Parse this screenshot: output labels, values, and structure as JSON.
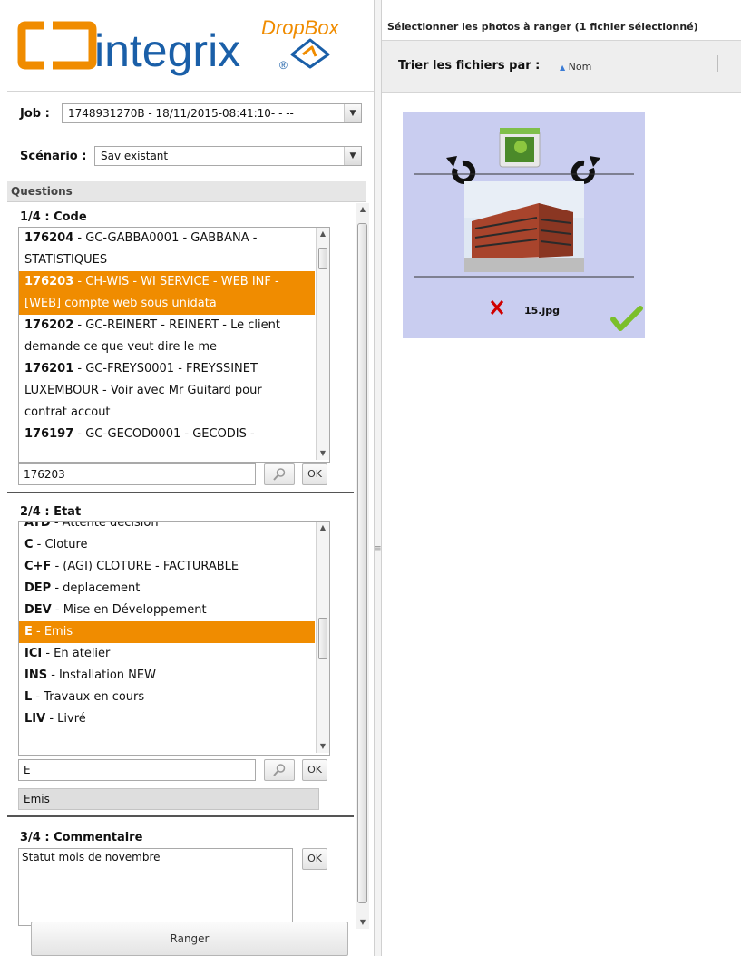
{
  "logo": {
    "brand": "integrix",
    "product": "DropBox"
  },
  "job": {
    "label": "Job :",
    "value": "1748931270B - 18/11/2015-08:41:10- - --"
  },
  "scenario": {
    "label": "Scénario :",
    "value": "Sav existant"
  },
  "questions_header": "Questions",
  "q1": {
    "title": "1/4 : Code",
    "items": [
      {
        "code": "176204",
        "text": " - GC-GABBA0001 - GABBANA - STATISTIQUES",
        "lines": [
          "STATISTIQUES"
        ],
        "first": " - GC-GABBA0001 - GABBANA -"
      },
      {
        "code": "176203",
        "first": " - CH-WIS - WI SERVICE - WEB INF -",
        "lines": [
          "[WEB] compte web sous unidata"
        ],
        "selected": true
      },
      {
        "code": "176202",
        "first": " - GC-REINERT - REINERT - Le client",
        "lines": [
          "demande ce que veut dire le me"
        ]
      },
      {
        "code": "176201",
        "first": " - GC-FREYS0001 - FREYSSINET",
        "lines": [
          "LUXEMBOUR - Voir avec Mr Guitard pour",
          "contrat accout"
        ]
      },
      {
        "code": "176197",
        "first": " - GC-GECOD0001 - GECODIS -",
        "lines": []
      }
    ],
    "input_value": "176203",
    "ok_label": "OK"
  },
  "q2": {
    "title": "2/4 : Etat",
    "items": [
      {
        "code": "ATD",
        "text": " - Attente décision"
      },
      {
        "code": "C",
        "text": " - Cloture"
      },
      {
        "code": "C+F",
        "text": " - (AGI) CLOTURE - FACTURABLE"
      },
      {
        "code": "DEP",
        "text": " - deplacement"
      },
      {
        "code": "DEV",
        "text": " - Mise en Développement"
      },
      {
        "code": "E",
        "text": " - Emis",
        "selected": true
      },
      {
        "code": "ICI",
        "text": " - En atelier"
      },
      {
        "code": "INS",
        "text": " - Installation NEW"
      },
      {
        "code": "L",
        "text": " - Travaux en cours"
      },
      {
        "code": "LIV",
        "text": " - Livré"
      }
    ],
    "input_value": "E",
    "ok_label": "OK",
    "result": "Emis"
  },
  "q3": {
    "title": "3/4 : Commentaire",
    "value": "Statut mois de novembre",
    "ok_label": "OK"
  },
  "ranger_label": "Ranger",
  "right": {
    "header": "Sélectionner les photos à ranger (1 fichier sélectionné)",
    "sort_label": "Trier les fichiers par :",
    "sort_field": "Nom",
    "file_name": "15.jpg"
  },
  "colors": {
    "selection": "#f08c00",
    "card_bg": "#c9cdf0",
    "logo_orange": "#f08c00",
    "logo_blue": "#1a5fa8"
  },
  "icons": [
    "rotate-left-icon",
    "photo-frame-icon",
    "rotate-right-icon",
    "delete-icon",
    "check-icon",
    "search-icon",
    "sort-asc-icon",
    "chevron-down-icon"
  ]
}
